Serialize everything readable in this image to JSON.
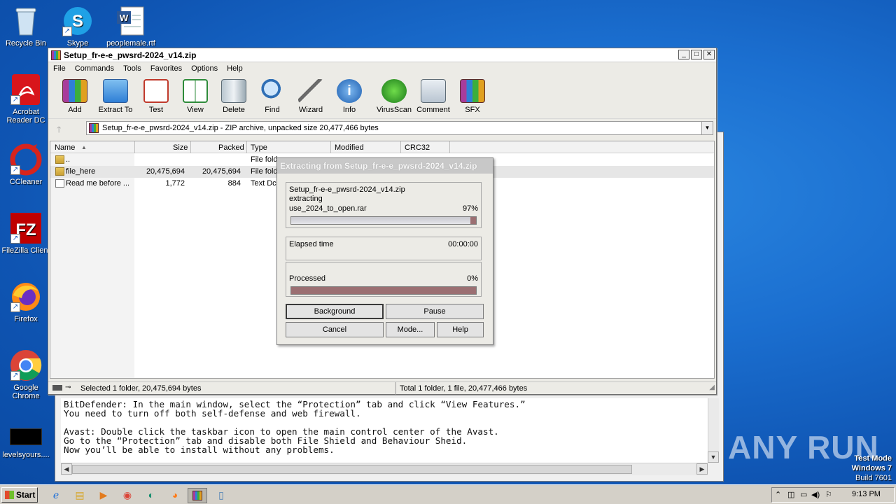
{
  "desktop": {
    "icons": [
      {
        "label": "Recycle Bin",
        "icon": "recycle-bin-icon"
      },
      {
        "label": "Skype",
        "icon": "skype-icon"
      },
      {
        "label": "peoplemale.rtf",
        "icon": "word-document-icon"
      },
      {
        "label": "Acrobat Reader DC",
        "icon": "acrobat-icon"
      },
      {
        "label": "CCleaner",
        "icon": "ccleaner-icon"
      },
      {
        "label": "FileZilla Client",
        "icon": "filezilla-icon"
      },
      {
        "label": "Firefox",
        "icon": "firefox-icon"
      },
      {
        "label": "Google Chrome",
        "icon": "chrome-icon"
      },
      {
        "label": "levelsyours....",
        "icon": "file-icon"
      }
    ],
    "watermark": "ANY RUN",
    "test_mode": {
      "line1": "Test Mode",
      "line2": "Windows 7",
      "line3": "Build 7601"
    }
  },
  "notepad": {
    "lines": "BitDefender: In the main window, select the “Protection” tab and click “View Features.”\nYou need to turn off both self-defense and web firewall.\n\nAvast: Double click the taskbar icon to open the main control center of the Avast.\nGo to the “Protection” tab and disable both File Shield and Behaviour Sheid.\nNow you’ll be able to install without any problems."
  },
  "winrar": {
    "title": "Setup_fr-e-e_pwsrd-2024_v14.zip",
    "menu": [
      "File",
      "Commands",
      "Tools",
      "Favorites",
      "Options",
      "Help"
    ],
    "toolbar": [
      "Add",
      "Extract To",
      "Test",
      "View",
      "Delete",
      "Find",
      "Wizard",
      "Info",
      "VirusScan",
      "Comment",
      "SFX"
    ],
    "address": "Setup_fr-e-e_pwsrd-2024_v14.zip - ZIP archive, unpacked size 20,477,466 bytes",
    "columns": {
      "name": "Name",
      "size": "Size",
      "packed": "Packed",
      "type": "Type",
      "modified": "Modified",
      "crc": "CRC32"
    },
    "rows": [
      {
        "name": "..",
        "size": "",
        "packed": "",
        "type": "File fold"
      },
      {
        "name": "file_here",
        "size": "20,475,694",
        "packed": "20,475,694",
        "type": "File fold"
      },
      {
        "name": "Read me before ...",
        "size": "1,772",
        "packed": "884",
        "type": "Text Dc"
      }
    ],
    "status_left": "Selected 1 folder, 20,475,694 bytes",
    "status_right": "Total 1 folder, 1 file, 20,477,466 bytes"
  },
  "dialog": {
    "title": "Extracting from Setup_fr-e-e_pwsrd-2024_v14.zip",
    "archive": "Setup_fr-e-e_pwsrd-2024_v14.zip",
    "action": "extracting",
    "file": "use_2024_to_open.rar",
    "file_percent": "97%",
    "file_progress": 0.97,
    "elapsed_label": "Elapsed time",
    "elapsed_value": "00:00:00",
    "processed_label": "Processed",
    "processed_percent": "0%",
    "buttons": {
      "background": "Background",
      "pause": "Pause",
      "cancel": "Cancel",
      "mode": "Mode...",
      "help": "Help"
    }
  },
  "taskbar": {
    "start": "Start",
    "clock": "9:13 PM"
  }
}
